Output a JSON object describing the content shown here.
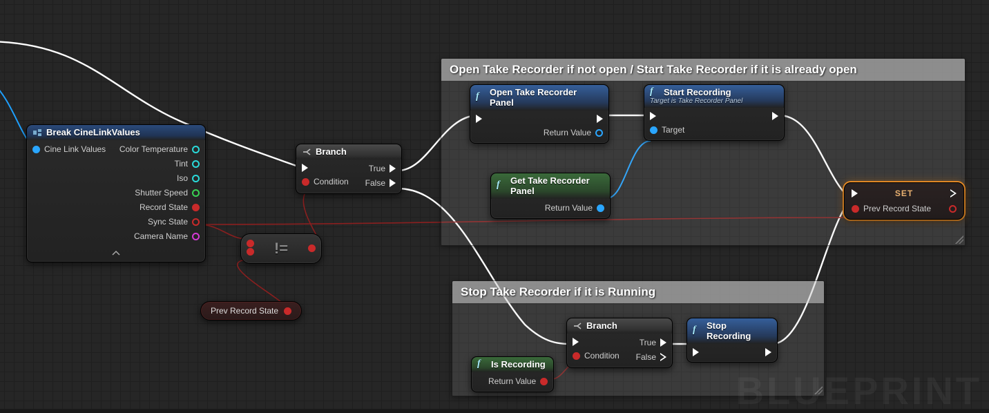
{
  "watermark": "BLUEPRINT",
  "comments": {
    "open": "Open Take Recorder if not open / Start Take Recorder if it is already open",
    "stop": "Stop Take Recorder if it is Running"
  },
  "break": {
    "title": "Break CineLinkValues",
    "input": "Cine Link Values",
    "outputs": {
      "color_temp": "Color Temperature",
      "tint": "Tint",
      "iso": "Iso",
      "shutter": "Shutter Speed",
      "record": "Record State",
      "sync": "Sync State",
      "camera": "Camera Name"
    }
  },
  "branch": {
    "title": "Branch",
    "condition": "Condition",
    "true": "True",
    "false": "False"
  },
  "open_panel": {
    "title": "Open Take Recorder Panel",
    "return": "Return Value"
  },
  "get_panel": {
    "title": "Get Take Recorder Panel",
    "return": "Return Value"
  },
  "start_rec": {
    "title": "Start Recording",
    "subtitle": "Target is Take Recorder Panel",
    "target": "Target"
  },
  "set": {
    "title": "SET",
    "pin": "Prev Record State"
  },
  "is_rec": {
    "title": "Is Recording",
    "return": "Return Value"
  },
  "stop_rec": {
    "title": "Stop Recording"
  },
  "neq_op": "!=",
  "prev_var": "Prev Record State"
}
